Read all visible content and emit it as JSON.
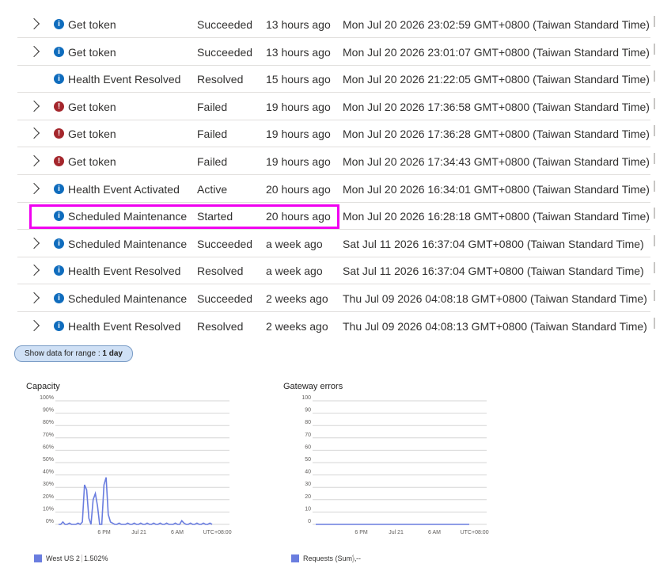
{
  "rows": [
    {
      "expand": true,
      "icon": "info-icon",
      "operation": "Get token",
      "status": "Succeeded",
      "age": "13 hours ago",
      "time": "Mon Jul 20 2026 23:02:59 GMT+0800 (Taiwan Standard Time)"
    },
    {
      "expand": true,
      "icon": "info-icon",
      "operation": "Get token",
      "status": "Succeeded",
      "age": "13 hours ago",
      "time": "Mon Jul 20 2026 23:01:07 GMT+0800 (Taiwan Standard Time)"
    },
    {
      "expand": false,
      "icon": "info-icon",
      "operation": "Health Event Resolved",
      "status": "Resolved",
      "age": "15 hours ago",
      "time": "Mon Jul 20 2026 21:22:05 GMT+0800 (Taiwan Standard Time)"
    },
    {
      "expand": true,
      "icon": "error-icon",
      "operation": "Get token",
      "status": "Failed",
      "age": "19 hours ago",
      "time": "Mon Jul 20 2026 17:36:58 GMT+0800 (Taiwan Standard Time)"
    },
    {
      "expand": true,
      "icon": "error-icon",
      "operation": "Get token",
      "status": "Failed",
      "age": "19 hours ago",
      "time": "Mon Jul 20 2026 17:36:28 GMT+0800 (Taiwan Standard Time)"
    },
    {
      "expand": true,
      "icon": "error-icon",
      "operation": "Get token",
      "status": "Failed",
      "age": "19 hours ago",
      "time": "Mon Jul 20 2026 17:34:43 GMT+0800 (Taiwan Standard Time)"
    },
    {
      "expand": true,
      "icon": "info-icon",
      "operation": "Health Event Activated",
      "status": "Active",
      "age": "20 hours ago",
      "time": "Mon Jul 20 2026 16:34:01 GMT+0800 (Taiwan Standard Time)"
    },
    {
      "expand": false,
      "icon": "info-icon",
      "operation": "Scheduled Maintenance",
      "status": "Started",
      "age": "20 hours ago",
      "time": "Mon Jul 20 2026 16:28:18 GMT+0800 (Taiwan Standard Time)"
    },
    {
      "expand": true,
      "icon": "info-icon",
      "operation": "Scheduled Maintenance",
      "status": "Succeeded",
      "age": "a week ago",
      "time": "Sat Jul 11 2026 16:37:04 GMT+0800 (Taiwan Standard Time)"
    },
    {
      "expand": true,
      "icon": "info-icon",
      "operation": "Health Event Resolved",
      "status": "Resolved",
      "age": "a week ago",
      "time": "Sat Jul 11 2026 16:37:04 GMT+0800 (Taiwan Standard Time)"
    },
    {
      "expand": true,
      "icon": "info-icon",
      "operation": "Scheduled Maintenance",
      "status": "Succeeded",
      "age": "2 weeks ago",
      "time": "Thu Jul 09 2026 04:08:18 GMT+0800 (Taiwan Standard Time)"
    },
    {
      "expand": true,
      "icon": "info-icon",
      "operation": "Health Event Resolved",
      "status": "Resolved",
      "age": "2 weeks ago",
      "time": "Thu Jul 09 2026 04:08:13 GMT+0800 (Taiwan Standard Time)"
    }
  ],
  "highlight_row_index": 7,
  "colors": {
    "info": "#0f6cbd",
    "error": "#a4262c",
    "highlight": "#f000f0",
    "series": "#6a7ddf"
  },
  "range_button": {
    "prefix": "Show data for range : ",
    "value": "1 day"
  },
  "charts": {
    "capacity": {
      "title": "Capacity",
      "yticks": [
        "100%",
        "90%",
        "80%",
        "70%",
        "60%",
        "50%",
        "40%",
        "30%",
        "20%",
        "10%",
        "0%"
      ],
      "xticks": [
        "6 PM",
        "Jul 21",
        "6 AM",
        "UTC+08:00"
      ],
      "legend": {
        "label": "West US 2",
        "value": "1.502%"
      }
    },
    "gateway": {
      "title": "Gateway errors",
      "yticks": [
        "100",
        "90",
        "80",
        "70",
        "60",
        "50",
        "40",
        "30",
        "20",
        "10",
        "0"
      ],
      "xticks": [
        "6 PM",
        "Jul 21",
        "6 AM",
        "UTC+08:00"
      ],
      "legend": {
        "label": "Requests (Sum),",
        "value": "--"
      }
    }
  },
  "chart_data": [
    {
      "type": "line",
      "title": "Capacity",
      "ylim": [
        0,
        100
      ],
      "yunit": "%",
      "x_labels": [
        "6 PM",
        "Jul 21",
        "6 AM",
        "UTC+08:00"
      ],
      "series": [
        {
          "name": "West US 2",
          "values": [
            0,
            0,
            2,
            0,
            0,
            1,
            0,
            0,
            0,
            1,
            0,
            2,
            32,
            28,
            5,
            0,
            20,
            25,
            15,
            0,
            0,
            32,
            38,
            8,
            2,
            1,
            0,
            0,
            1,
            0,
            0,
            0,
            1,
            0,
            0,
            1,
            0,
            0,
            1,
            0,
            0,
            1,
            0,
            0,
            1,
            0,
            0,
            1,
            0,
            0,
            1,
            0,
            0,
            0,
            1,
            0,
            0,
            3,
            1,
            0,
            0,
            1,
            0,
            0,
            1,
            0,
            0,
            1,
            0,
            0,
            1,
            0
          ]
        }
      ],
      "grid": true
    },
    {
      "type": "line",
      "title": "Gateway errors",
      "ylim": [
        0,
        100
      ],
      "x_labels": [
        "6 PM",
        "Jul 21",
        "6 AM",
        "UTC+08:00"
      ],
      "series": [
        {
          "name": "Requests (Sum),",
          "values": [
            0,
            0,
            0,
            0,
            0,
            0,
            0,
            0,
            0,
            0,
            0,
            0,
            0,
            0,
            0,
            0,
            0,
            0,
            0,
            0,
            0,
            0,
            0,
            0,
            0,
            0,
            0,
            0,
            0,
            0,
            0,
            0,
            0,
            0,
            0,
            0,
            0,
            0,
            0,
            0,
            0,
            0,
            0,
            0,
            0,
            0,
            0,
            0,
            0,
            0,
            0,
            0,
            0,
            0,
            0,
            0,
            0,
            0,
            0,
            0,
            0,
            0,
            0,
            0,
            0,
            0,
            0,
            0,
            0,
            0,
            0,
            0
          ]
        }
      ],
      "grid": true
    }
  ]
}
